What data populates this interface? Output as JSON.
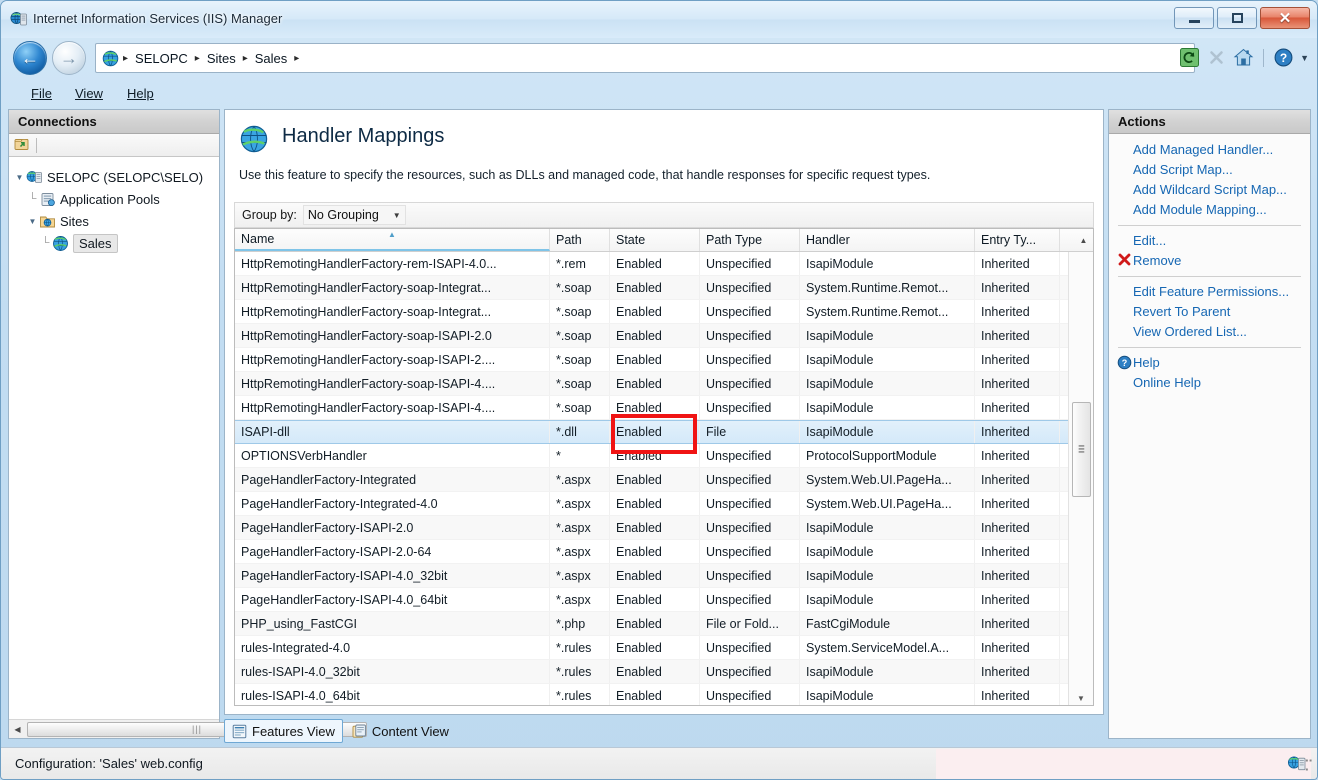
{
  "window": {
    "title": "Internet Information Services (IIS) Manager",
    "icon": "iis-manager-icon",
    "buttons": {
      "minimize": "minimize",
      "maximize": "maximize",
      "close": "close"
    }
  },
  "navigation": {
    "back_label": "Back",
    "forward_label": "Forward",
    "breadcrumb": [
      "SELOPC",
      "Sites",
      "Sales"
    ],
    "breadcrumb_separator": "▸",
    "toolbar_icons": [
      "refresh-icon",
      "stop-icon",
      "home-icon",
      "help-icon",
      "help-dropdown-caret"
    ]
  },
  "menubar": {
    "items": [
      {
        "label": "File",
        "accel": "F"
      },
      {
        "label": "View",
        "accel": "V"
      },
      {
        "label": "Help",
        "accel": "H"
      }
    ]
  },
  "connections": {
    "header": "Connections",
    "toolbar_icons": [
      "connect-to-site-icon"
    ],
    "tree": [
      {
        "label": "SELOPC (SELOPC\\SELO)",
        "icon": "server-icon",
        "level": 0,
        "expanded": true,
        "selected": false
      },
      {
        "label": "Application Pools",
        "icon": "application-pools-icon",
        "level": 1,
        "expanded": null,
        "selected": false
      },
      {
        "label": "Sites",
        "icon": "sites-folder-icon",
        "level": 1,
        "expanded": true,
        "selected": false
      },
      {
        "label": "Sales",
        "icon": "site-globe-icon",
        "level": 2,
        "expanded": null,
        "selected": true
      }
    ]
  },
  "feature": {
    "icon": "handler-mappings-globe-icon",
    "title": "Handler Mappings",
    "description": "Use this feature to specify the resources, such as DLLs and managed code, that handle responses for specific request types.",
    "group_by_label": "Group by:",
    "group_by_value": "No Grouping"
  },
  "grid": {
    "columns": [
      "Name",
      "Path",
      "State",
      "Path Type",
      "Handler",
      "Entry Ty..."
    ],
    "sorted_column": "Name",
    "sort_direction": "ascending",
    "rows": [
      {
        "name": "HttpRemotingHandlerFactory-rem-ISAPI-4.0...",
        "path": "*.rem",
        "state": "Enabled",
        "path_type": "Unspecified",
        "handler": "IsapiModule",
        "entry_type": "Inherited",
        "selected": false
      },
      {
        "name": "HttpRemotingHandlerFactory-soap-Integrat...",
        "path": "*.soap",
        "state": "Enabled",
        "path_type": "Unspecified",
        "handler": "System.Runtime.Remot...",
        "entry_type": "Inherited",
        "selected": false
      },
      {
        "name": "HttpRemotingHandlerFactory-soap-Integrat...",
        "path": "*.soap",
        "state": "Enabled",
        "path_type": "Unspecified",
        "handler": "System.Runtime.Remot...",
        "entry_type": "Inherited",
        "selected": false
      },
      {
        "name": "HttpRemotingHandlerFactory-soap-ISAPI-2.0",
        "path": "*.soap",
        "state": "Enabled",
        "path_type": "Unspecified",
        "handler": "IsapiModule",
        "entry_type": "Inherited",
        "selected": false
      },
      {
        "name": "HttpRemotingHandlerFactory-soap-ISAPI-2....",
        "path": "*.soap",
        "state": "Enabled",
        "path_type": "Unspecified",
        "handler": "IsapiModule",
        "entry_type": "Inherited",
        "selected": false
      },
      {
        "name": "HttpRemotingHandlerFactory-soap-ISAPI-4....",
        "path": "*.soap",
        "state": "Enabled",
        "path_type": "Unspecified",
        "handler": "IsapiModule",
        "entry_type": "Inherited",
        "selected": false
      },
      {
        "name": "HttpRemotingHandlerFactory-soap-ISAPI-4....",
        "path": "*.soap",
        "state": "Enabled",
        "path_type": "Unspecified",
        "handler": "IsapiModule",
        "entry_type": "Inherited",
        "selected": false
      },
      {
        "name": "ISAPI-dll",
        "path": "*.dll",
        "state": "Enabled",
        "path_type": "File",
        "handler": "IsapiModule",
        "entry_type": "Inherited",
        "selected": true
      },
      {
        "name": "OPTIONSVerbHandler",
        "path": "*",
        "state": "Enabled",
        "path_type": "Unspecified",
        "handler": "ProtocolSupportModule",
        "entry_type": "Inherited",
        "selected": false
      },
      {
        "name": "PageHandlerFactory-Integrated",
        "path": "*.aspx",
        "state": "Enabled",
        "path_type": "Unspecified",
        "handler": "System.Web.UI.PageHa...",
        "entry_type": "Inherited",
        "selected": false
      },
      {
        "name": "PageHandlerFactory-Integrated-4.0",
        "path": "*.aspx",
        "state": "Enabled",
        "path_type": "Unspecified",
        "handler": "System.Web.UI.PageHa...",
        "entry_type": "Inherited",
        "selected": false
      },
      {
        "name": "PageHandlerFactory-ISAPI-2.0",
        "path": "*.aspx",
        "state": "Enabled",
        "path_type": "Unspecified",
        "handler": "IsapiModule",
        "entry_type": "Inherited",
        "selected": false
      },
      {
        "name": "PageHandlerFactory-ISAPI-2.0-64",
        "path": "*.aspx",
        "state": "Enabled",
        "path_type": "Unspecified",
        "handler": "IsapiModule",
        "entry_type": "Inherited",
        "selected": false
      },
      {
        "name": "PageHandlerFactory-ISAPI-4.0_32bit",
        "path": "*.aspx",
        "state": "Enabled",
        "path_type": "Unspecified",
        "handler": "IsapiModule",
        "entry_type": "Inherited",
        "selected": false
      },
      {
        "name": "PageHandlerFactory-ISAPI-4.0_64bit",
        "path": "*.aspx",
        "state": "Enabled",
        "path_type": "Unspecified",
        "handler": "IsapiModule",
        "entry_type": "Inherited",
        "selected": false
      },
      {
        "name": "PHP_using_FastCGI",
        "path": "*.php",
        "state": "Enabled",
        "path_type": "File or Fold...",
        "handler": "FastCgiModule",
        "entry_type": "Inherited",
        "selected": false
      },
      {
        "name": "rules-Integrated-4.0",
        "path": "*.rules",
        "state": "Enabled",
        "path_type": "Unspecified",
        "handler": "System.ServiceModel.A...",
        "entry_type": "Inherited",
        "selected": false
      },
      {
        "name": "rules-ISAPI-4.0_32bit",
        "path": "*.rules",
        "state": "Enabled",
        "path_type": "Unspecified",
        "handler": "IsapiModule",
        "entry_type": "Inherited",
        "selected": false
      },
      {
        "name": "rules-ISAPI-4.0_64bit",
        "path": "*.rules",
        "state": "Enabled",
        "path_type": "Unspecified",
        "handler": "IsapiModule",
        "entry_type": "Inherited",
        "selected": false
      }
    ]
  },
  "annotation": {
    "type": "rectangle-highlight",
    "color": "#f01414",
    "target_text": "Enabled",
    "target_row": "ISAPI-dll",
    "target_column": "State"
  },
  "view_tabs": [
    {
      "label": "Features View",
      "icon": "features-view-icon",
      "active": true
    },
    {
      "label": "Content View",
      "icon": "content-view-icon",
      "active": false
    }
  ],
  "actions": {
    "header": "Actions",
    "groups": [
      {
        "items": [
          {
            "label": "Add Managed Handler...",
            "icon": null
          },
          {
            "label": "Add Script Map...",
            "icon": null
          },
          {
            "label": "Add Wildcard Script Map...",
            "icon": null
          },
          {
            "label": "Add Module Mapping...",
            "icon": null
          }
        ]
      },
      {
        "items": [
          {
            "label": "Edit...",
            "icon": null
          },
          {
            "label": "Remove",
            "icon": "remove-x-icon"
          }
        ]
      },
      {
        "items": [
          {
            "label": "Edit Feature Permissions...",
            "icon": null
          },
          {
            "label": "Revert To Parent",
            "icon": null
          },
          {
            "label": "View Ordered List...",
            "icon": null
          }
        ]
      },
      {
        "items": [
          {
            "label": "Help",
            "icon": "help-circle-icon"
          },
          {
            "label": "Online Help",
            "icon": null
          }
        ]
      }
    ]
  },
  "statusbar": {
    "text": "Configuration: 'Sales' web.config",
    "icon": "iis-status-icon"
  },
  "colors": {
    "accent_link": "#1667b3",
    "annotation_red": "#f01414",
    "selection_blue": "#d4e9f9",
    "window_chrome": "#c2ddf2"
  }
}
